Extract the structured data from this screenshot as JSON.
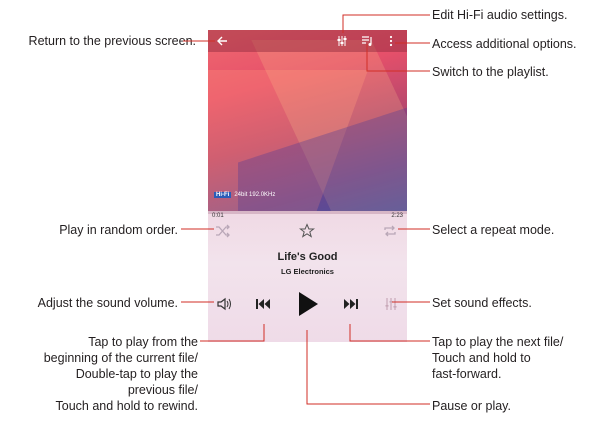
{
  "callouts": {
    "back": "Return to the previous screen.",
    "random": "Play in random order.",
    "volume": "Adjust the sound volume.",
    "previous_1": "Tap to play from the",
    "previous_2": "beginning of the current file/",
    "previous_3": "Double-tap to play the",
    "previous_4": "previous file/",
    "previous_5": "Touch and hold to rewind.",
    "hifi_settings": "Edit Hi-Fi audio settings.",
    "options": "Access additional options.",
    "playlist": "Switch to the playlist.",
    "repeat": "Select a repeat mode.",
    "effects": "Set sound effects.",
    "next_1": "Tap to play the next file/",
    "next_2": "Touch and hold to",
    "next_3": "fast-forward.",
    "play_pause": "Pause or play."
  },
  "player": {
    "hifi_badge": "Hi-Fi",
    "format": "24bit 192.0KHz",
    "elapsed": "0:01",
    "duration": "2:23",
    "song_title": "Life's Good",
    "artist": "LG Electronics"
  },
  "colors": {
    "accent": "#2a5db8",
    "line": "#d12e26"
  },
  "icons": [
    "back-arrow-icon",
    "hifi-settings-icon",
    "playlist-icon",
    "more-options-icon",
    "shuffle-icon",
    "star-icon",
    "repeat-icon",
    "volume-icon",
    "previous-icon",
    "play-icon",
    "next-icon",
    "equalizer-icon"
  ]
}
